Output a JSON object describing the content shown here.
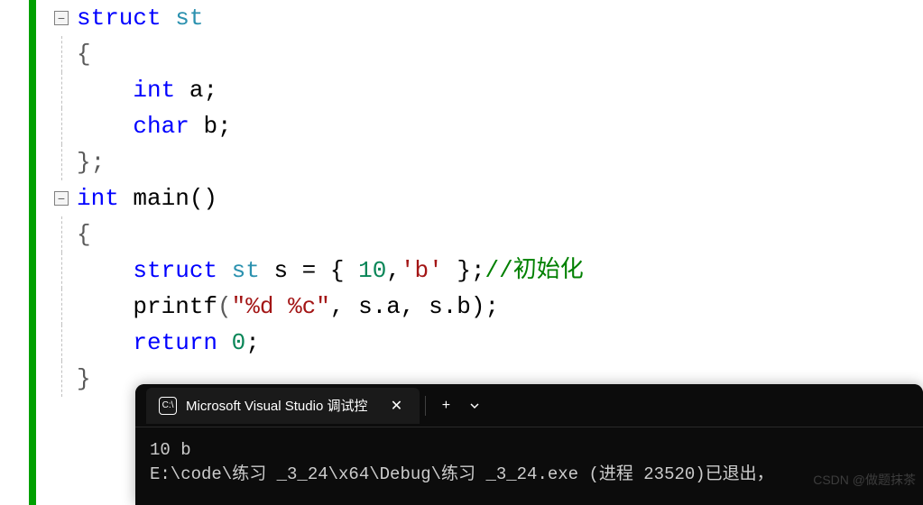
{
  "code": {
    "l1_struct": "struct",
    "l1_type": "st",
    "l2_brace": "{",
    "l3_kw": "int",
    "l3_id": " a;",
    "l4_kw": "char",
    "l4_id": " b;",
    "l5_close": "};",
    "l6_kw": "int",
    "l6_main": " main()",
    "l7_brace": "{",
    "l8_struct": "struct",
    "l8_type": "st",
    "l8_var": " s = { ",
    "l8_num": "10",
    "l8_mid": ",",
    "l8_char": "'b'",
    "l8_end": " };",
    "l8_comment": "//初始化",
    "l9_printf": "printf",
    "l9_open": "(",
    "l9_str": "\"%d %c\"",
    "l9_args": ", s.a, s.b);",
    "l10_return": "return",
    "l10_val": " 0",
    "l10_semi": ";",
    "l11_brace": "}"
  },
  "terminal": {
    "tab_title": "Microsoft Visual Studio 调试控",
    "output_line1": "10 b",
    "output_line2": "E:\\code\\练习 _3_24\\x64\\Debug\\练习 _3_24.exe (进程 23520)已退出，"
  },
  "watermark": "CSDN @做题抹茶"
}
